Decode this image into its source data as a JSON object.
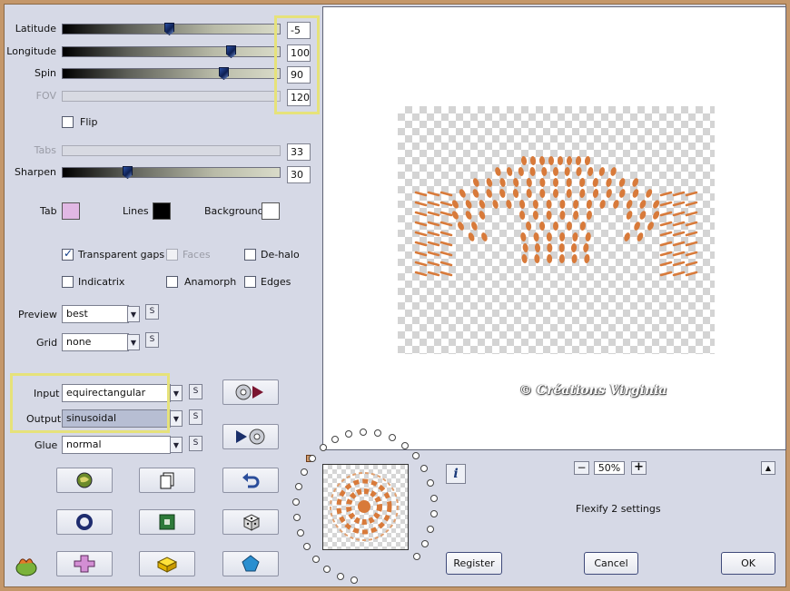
{
  "params": {
    "latitude": {
      "label": "Latitude",
      "value": "-5",
      "level": 0.49,
      "annotation": "- 5"
    },
    "longitude": {
      "label": "Longitude",
      "value": "100",
      "level": 0.77,
      "annotation": "100"
    },
    "spin": {
      "label": "Spin",
      "value": "90",
      "level": 0.74,
      "annotation": "90"
    },
    "fov": {
      "label": "FOV",
      "value": "120",
      "disabled": true
    },
    "tabs": {
      "label": "Tabs",
      "value": "33",
      "disabled": true
    },
    "sharpen": {
      "label": "Sharpen",
      "value": "30",
      "level": 0.3
    }
  },
  "flip": {
    "label": "Flip",
    "checked": false
  },
  "colors": {
    "tab": {
      "label": "Tab",
      "color": "#e1b8e4"
    },
    "lines": {
      "label": "Lines",
      "color": "#000000"
    },
    "background": {
      "label": "Background",
      "color": "#ffffff"
    }
  },
  "options": {
    "transparent_gaps": {
      "label": "Transparent gaps",
      "checked": true
    },
    "faces": {
      "label": "Faces",
      "checked": false,
      "disabled": true
    },
    "de_halo": {
      "label": "De-halo",
      "checked": false
    },
    "indicatrix": {
      "label": "Indicatrix",
      "checked": false
    },
    "anamorph": {
      "label": "Anamorph",
      "checked": false
    },
    "edges": {
      "label": "Edges",
      "checked": false
    }
  },
  "dropdowns": {
    "preview": {
      "label": "Preview",
      "value": "best"
    },
    "grid": {
      "label": "Grid",
      "value": "none"
    },
    "input": {
      "label": "Input",
      "value": "equirectangular"
    },
    "output": {
      "label": "Output",
      "value": "sinusoidal"
    },
    "glue": {
      "label": "Glue",
      "value": "normal"
    }
  },
  "s_label": "S",
  "zoom": {
    "value": "50%",
    "minus": "−",
    "plus": "+"
  },
  "status": "Flexify 2 settings",
  "watermark": "© Créations Virginia",
  "info_label": "i",
  "buttons": {
    "register": "Register",
    "cancel": "Cancel",
    "ok": "OK"
  },
  "accent": {
    "highlight": "#e6e27a",
    "annotation": "#7a3020",
    "preview_orange": "#d87a3a"
  }
}
